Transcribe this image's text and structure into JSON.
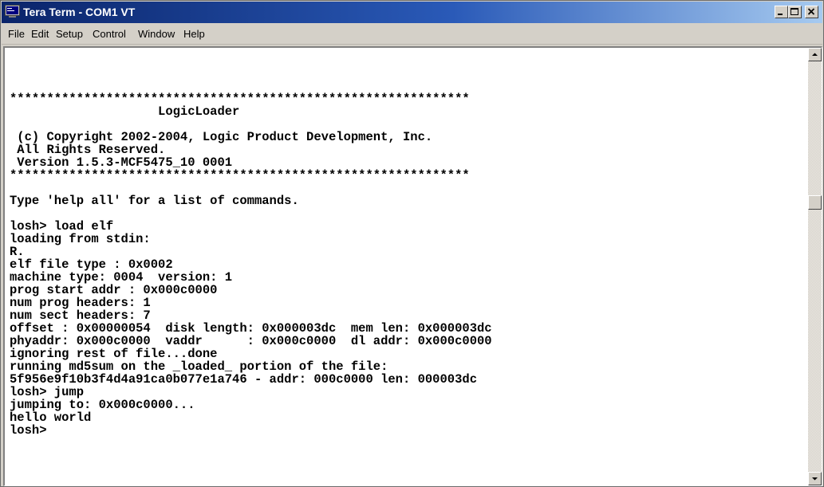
{
  "window": {
    "title": "Tera Term - COM1 VT",
    "icon": "teraterm-app-icon"
  },
  "controls": {
    "minimize_icon": "minimize-icon",
    "maximize_icon": "maximize-icon",
    "close_icon": "close-icon"
  },
  "menu": {
    "items": [
      {
        "label": "File"
      },
      {
        "label": "Edit"
      },
      {
        "label": "Setup"
      },
      {
        "label": "Control"
      },
      {
        "label": "Window"
      },
      {
        "label": "Help"
      }
    ]
  },
  "terminal": {
    "lines": [
      "**************************************************************",
      "                    LogicLoader",
      "",
      " (c) Copyright 2002-2004, Logic Product Development, Inc.",
      " All Rights Reserved.",
      " Version 1.5.3-MCF5475_10 0001",
      "**************************************************************",
      "",
      "Type 'help all' for a list of commands.",
      "",
      "losh> load elf",
      "loading from stdin:",
      "R.",
      "elf file type : 0x0002",
      "machine type: 0004  version: 1",
      "prog start addr : 0x000c0000",
      "num prog headers: 1",
      "num sect headers: 7",
      "offset : 0x00000054  disk length: 0x000003dc  mem len: 0x000003dc",
      "phyaddr: 0x000c0000  vaddr      : 0x000c0000  dl addr: 0x000c0000",
      "ignoring rest of file...done",
      "running md5sum on the _loaded_ portion of the file:",
      "5f956e9f10b3f4d4a91ca0b077e1a746 - addr: 000c0000 len: 000003dc",
      "losh> jump",
      "jumping to: 0x000c0000...",
      "hello world",
      "losh>"
    ]
  },
  "scrollbar": {
    "up_icon": "scroll-up-arrow-icon",
    "down_icon": "scroll-down-arrow-icon"
  },
  "colors": {
    "titlebar_start": "#0a246a",
    "titlebar_end": "#a6caf0",
    "chrome": "#d4d0c8",
    "terminal_bg": "#ffffff",
    "terminal_fg": "#000000"
  }
}
